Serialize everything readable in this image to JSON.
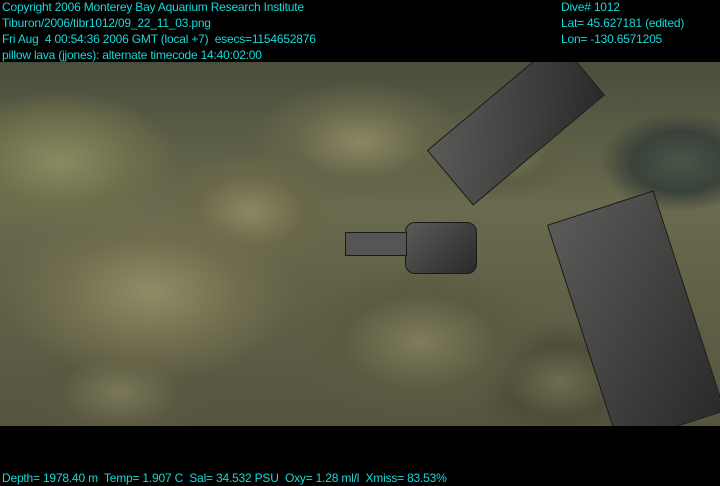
{
  "overlay_top_left": [
    "Copyright 2006 Monterey Bay Aquarium Research Institute",
    "Tiburon/2006/tibr1012/09_22_11_03.png",
    "Fri Aug  4 00:54:36 2006 GMT (local +7)  esecs=1154652876",
    "pillow lava (jjones): alternate timecode 14:40:02:00"
  ],
  "overlay_top_right": [
    "Dive# 1012",
    "Lat= 45.627181 (edited)",
    "Lon= -130.6571205"
  ],
  "overlay_bottom": "Depth= 1978.40 m  Temp= 1.907 C  Sal= 34.532 PSU  Oxy= 1.28 ml/l  Xmiss= 83.53%",
  "colors": {
    "overlay_text": "#18d8d8"
  }
}
